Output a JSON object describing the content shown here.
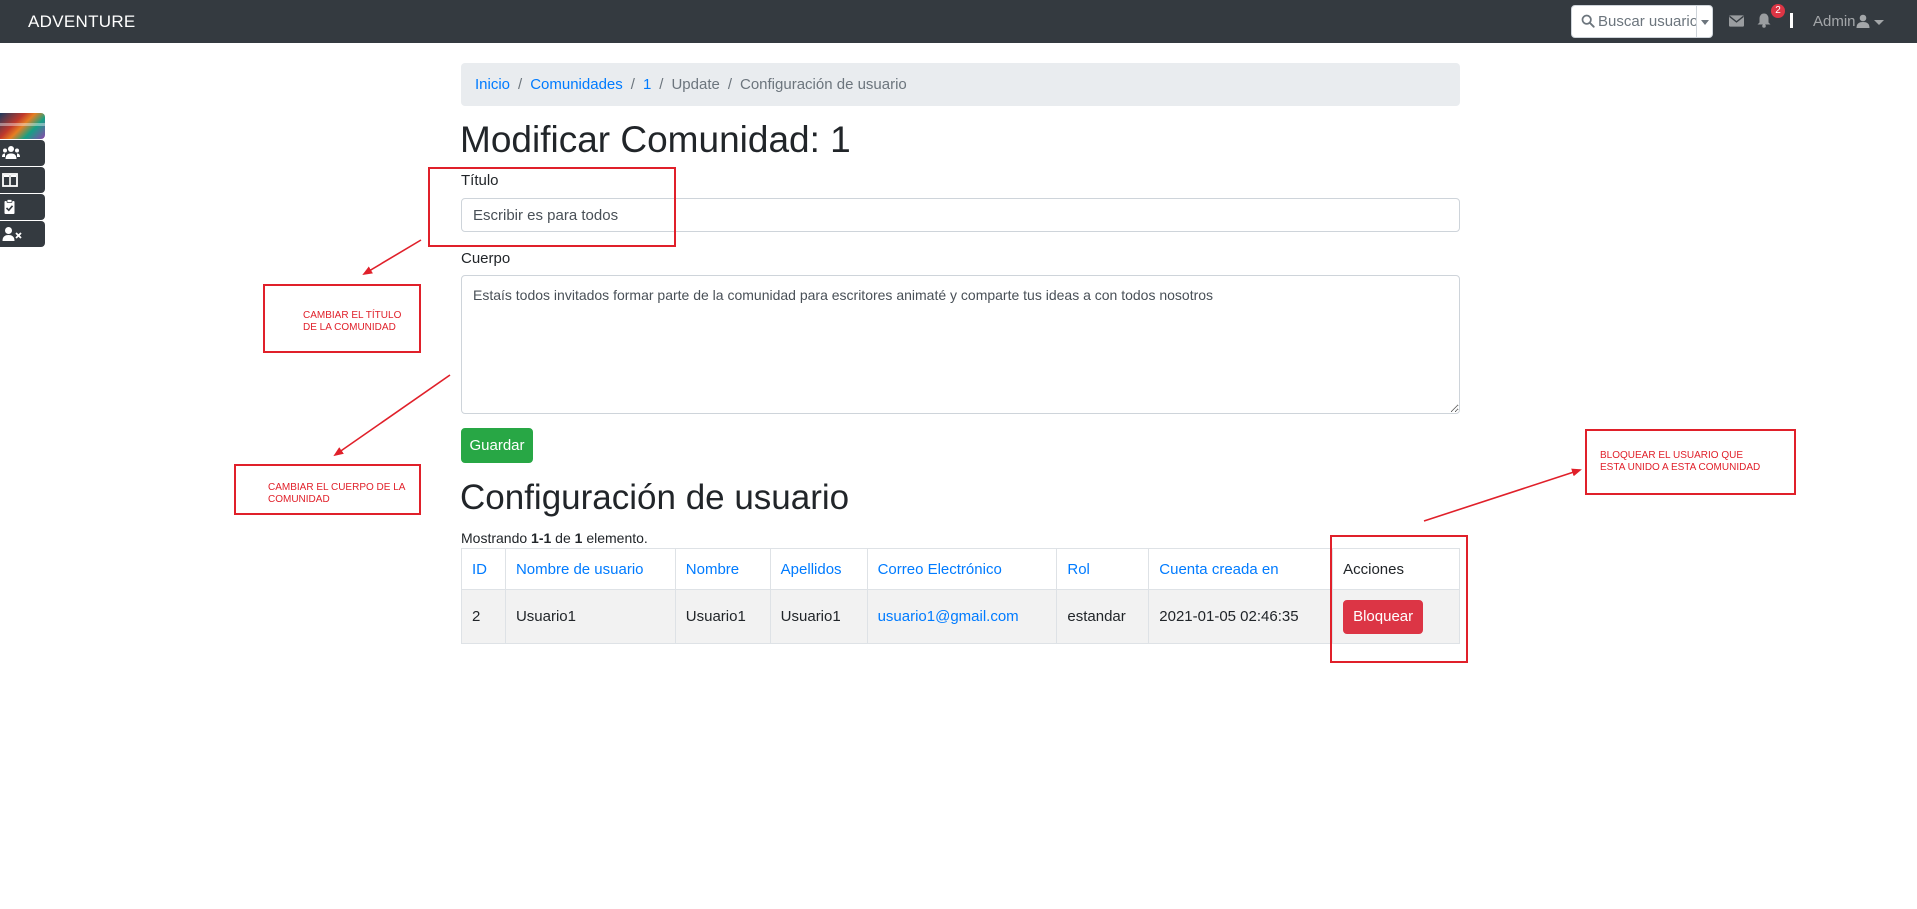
{
  "navbar": {
    "brand": "ADVENTURE",
    "search_placeholder": "Buscar usuario",
    "notification_count": "2",
    "user_label": "Admin"
  },
  "sidebar": {
    "items": [
      "thumbnail",
      "users-icon",
      "book-open-icon",
      "clipboard-check-icon",
      "user-times-icon"
    ]
  },
  "breadcrumb": {
    "items": [
      {
        "label": "Inicio",
        "link": true
      },
      {
        "label": "Comunidades",
        "link": true
      },
      {
        "label": "1",
        "link": true
      },
      {
        "label": "Update",
        "link": false
      },
      {
        "label": "Configuración de usuario",
        "link": false
      }
    ]
  },
  "form": {
    "title": "Modificar Comunidad: 1",
    "titulo_label": "Título",
    "titulo_value": "Escribir es para todos",
    "cuerpo_label": "Cuerpo",
    "cuerpo_value": "Estaís todos invitados formar parte de la comunidad para escritores animaté y comparte tus ideas a con todos nosotros",
    "save_label": "Guardar"
  },
  "users_section": {
    "title": "Configuración de usuario",
    "summary": {
      "prefix": "Mostrando",
      "range": "1-1",
      "middle": "de",
      "total": "1",
      "suffix": "elemento."
    },
    "columns": [
      "ID",
      "Nombre de usuario",
      "Nombre",
      "Apellidos",
      "Correo Electrónico",
      "Rol",
      "Cuenta creada en",
      "Acciones"
    ],
    "rows": [
      {
        "id": "2",
        "username": "Usuario1",
        "nombre": "Usuario1",
        "apellidos": "Usuario1",
        "email": "usuario1@gmail.com",
        "rol": "estandar",
        "created": "2021-01-05 02:46:35",
        "action_label": "Bloquear"
      }
    ]
  },
  "annotations": {
    "title_note": "CAMBIAR EL TÍTULO DE LA COMUNIDAD",
    "body_note": "CAMBIAR EL CUERPO DE LA COMUNIDAD",
    "block_note": "BLOQUEAR EL USUARIO QUE ESTA UNIDO A ESTA COMUNIDAD"
  },
  "colors": {
    "navbar": "#343a40",
    "primary": "#007bff",
    "success": "#28a745",
    "danger": "#dc3545",
    "annotation": "#e0202a"
  }
}
